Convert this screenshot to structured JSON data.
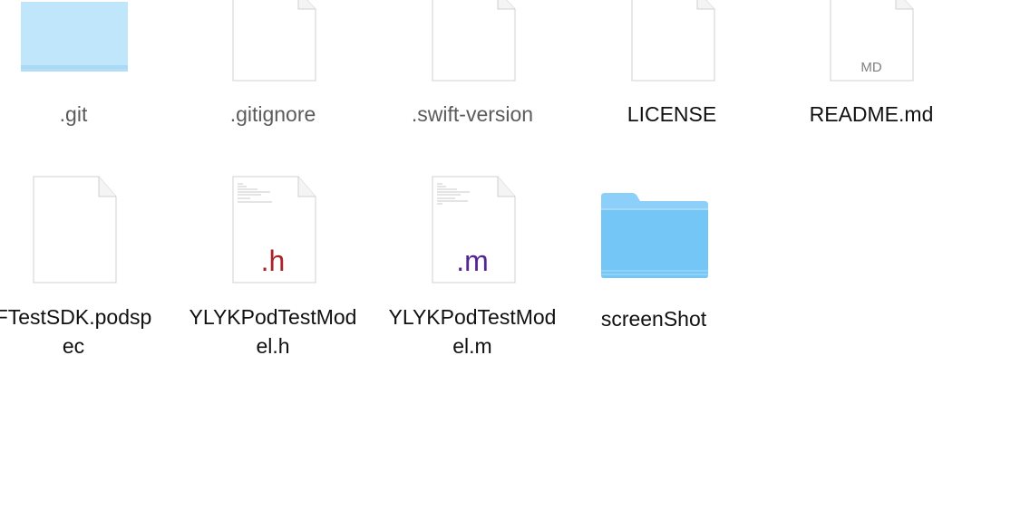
{
  "files": [
    {
      "name": ".git",
      "kind": "folder",
      "hidden": true,
      "icon": "folder-icon"
    },
    {
      "name": ".gitignore",
      "kind": "document",
      "hidden": true,
      "icon": "blank-document-icon"
    },
    {
      "name": ".swift-version",
      "kind": "document",
      "hidden": true,
      "icon": "blank-document-icon"
    },
    {
      "name": "LICENSE",
      "kind": "document",
      "hidden": false,
      "icon": "blank-document-icon"
    },
    {
      "name": "README.md",
      "kind": "document",
      "hidden": false,
      "icon": "markdown-document-icon",
      "badge": "MD"
    },
    {
      "name": "FTestSDK.podspec",
      "display_lines": "FTestSDK.podsp\nec",
      "kind": "document",
      "hidden": false,
      "icon": "blank-document-icon"
    },
    {
      "name": "YLYKPodTestModel.h",
      "display_lines": "YLYKPodTestMod\nel.h",
      "kind": "source",
      "hidden": false,
      "icon": "header-file-icon",
      "badge": ".h",
      "badge_color": "#a8232a"
    },
    {
      "name": "YLYKPodTestModel.m",
      "display_lines": "YLYKPodTestMod\nel.m",
      "kind": "source",
      "hidden": false,
      "icon": "objc-source-file-icon",
      "badge": ".m",
      "badge_color": "#55268f"
    },
    {
      "name": "screenShot",
      "kind": "folder",
      "hidden": false,
      "icon": "folder-icon"
    }
  ],
  "colors": {
    "folder_top": "#8ccff8",
    "folder_body": "#74c6f6",
    "hidden_folder": "#bfe6fb",
    "hidden_text": "#5b5b5b",
    "text": "#111111"
  }
}
